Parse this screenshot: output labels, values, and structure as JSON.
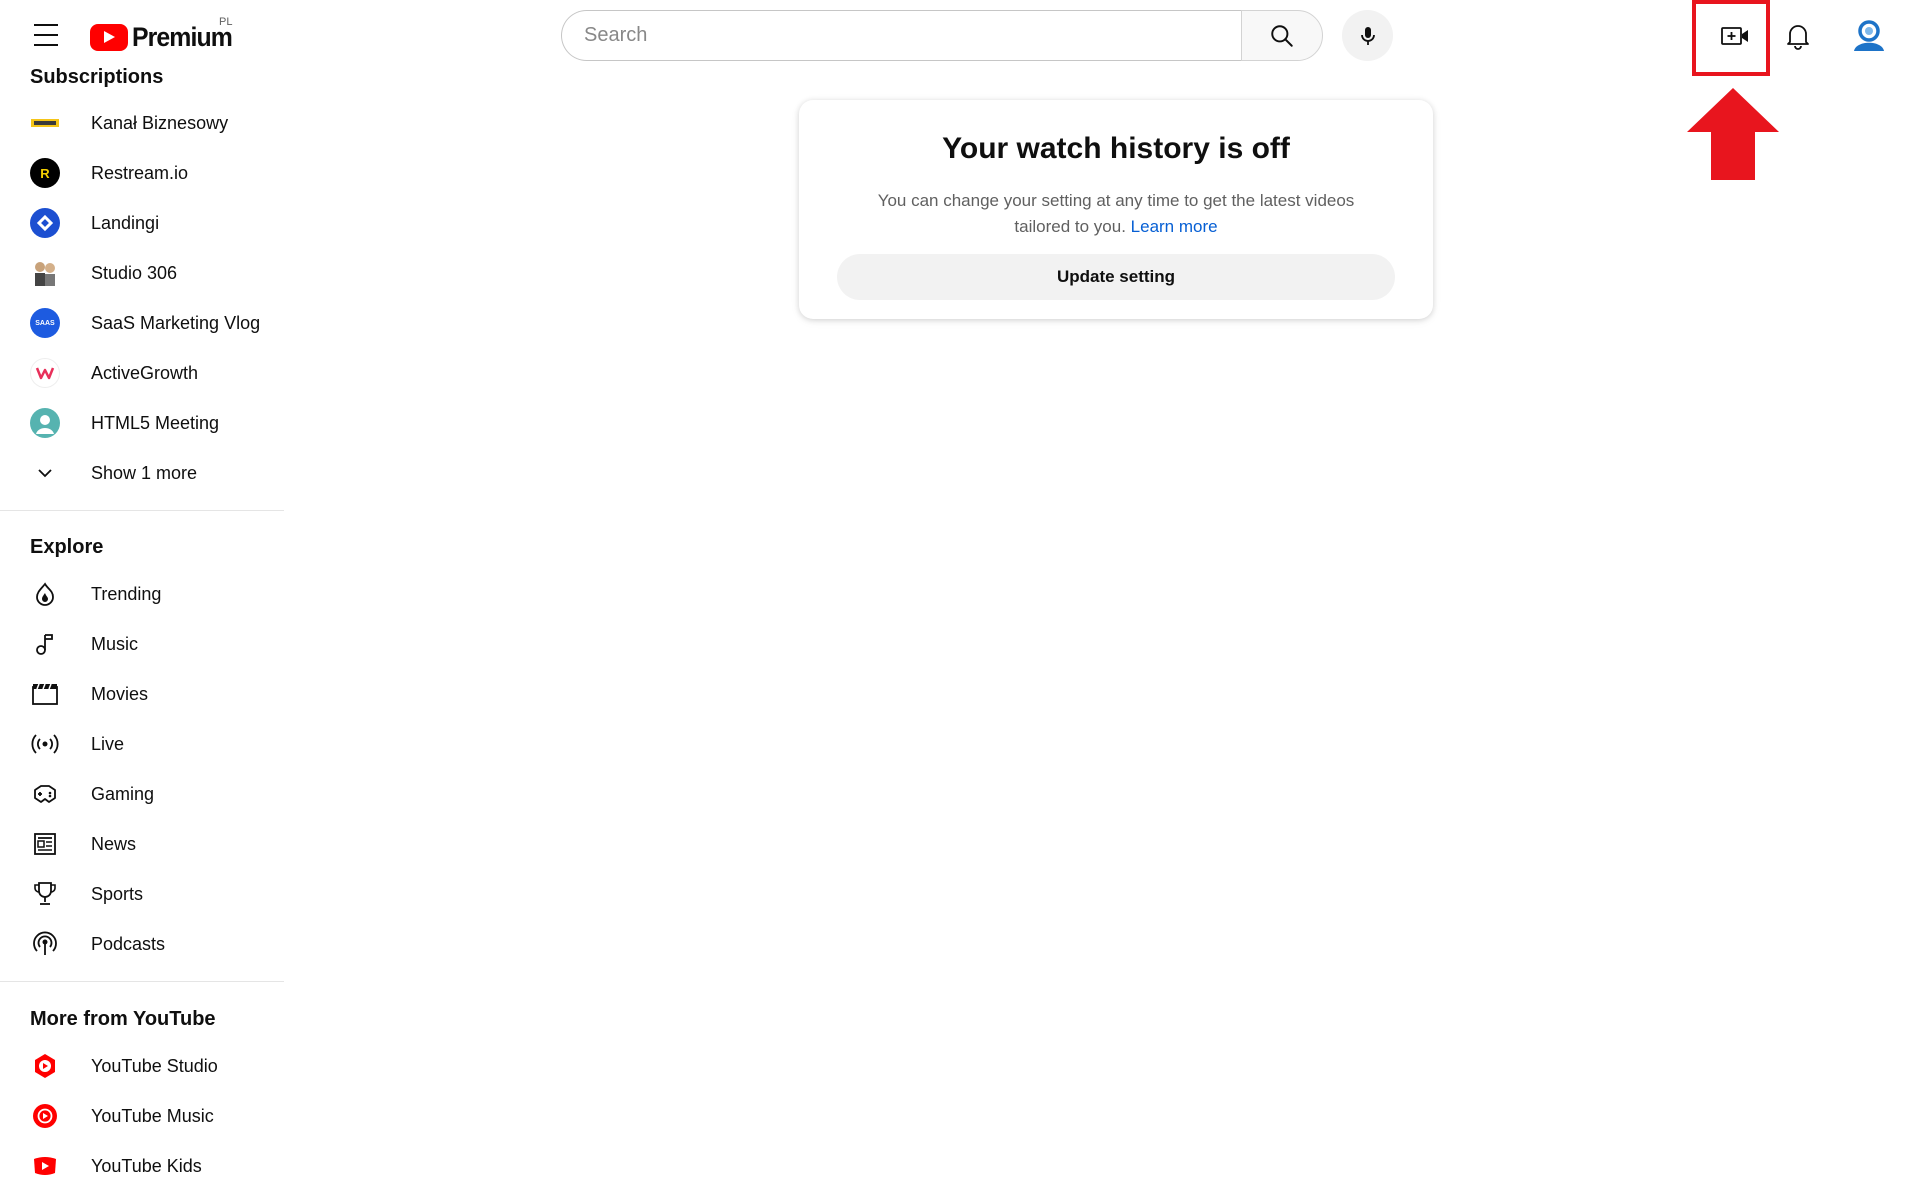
{
  "header": {
    "logo_text": "Premium",
    "country_code": "PL",
    "search_placeholder": "Search"
  },
  "sidebar": {
    "subscriptions_title": "Subscriptions",
    "subscriptions": [
      {
        "label": "Kanał Biznesowy"
      },
      {
        "label": "Restream.io"
      },
      {
        "label": "Landingi"
      },
      {
        "label": "Studio 306"
      },
      {
        "label": "SaaS Marketing Vlog"
      },
      {
        "label": "ActiveGrowth"
      },
      {
        "label": "HTML5 Meeting"
      }
    ],
    "show_more_label": "Show 1 more",
    "explore_title": "Explore",
    "explore": [
      {
        "label": "Trending",
        "icon": "trending-icon"
      },
      {
        "label": "Music",
        "icon": "music-icon"
      },
      {
        "label": "Movies",
        "icon": "movies-icon"
      },
      {
        "label": "Live",
        "icon": "live-icon"
      },
      {
        "label": "Gaming",
        "icon": "gaming-icon"
      },
      {
        "label": "News",
        "icon": "news-icon"
      },
      {
        "label": "Sports",
        "icon": "sports-icon"
      },
      {
        "label": "Podcasts",
        "icon": "podcasts-icon"
      }
    ],
    "more_title": "More from YouTube",
    "more": [
      {
        "label": "YouTube Studio",
        "icon": "youtube-studio-icon"
      },
      {
        "label": "YouTube Music",
        "icon": "youtube-music-icon"
      },
      {
        "label": "YouTube Kids",
        "icon": "youtube-kids-icon"
      }
    ]
  },
  "main": {
    "card_title": "Your watch history is off",
    "card_text": "You can change your setting at any time to get the latest videos tailored to you.",
    "card_link": "Learn more",
    "card_button": "Update setting"
  },
  "colors": {
    "brand_red": "#ff0000",
    "annotation_red": "#e8151e",
    "link_blue": "#065fd4"
  }
}
